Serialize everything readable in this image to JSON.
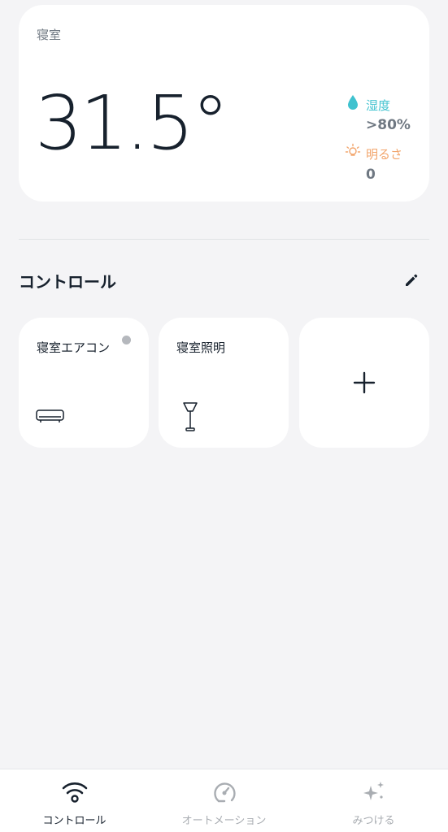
{
  "room": {
    "name": "寝室",
    "temperature": "31.5°",
    "humidity_label": "湿度",
    "humidity_value": ">80%",
    "brightness_label": "明るさ",
    "brightness_value": "0"
  },
  "controls": {
    "title": "コントロール",
    "tiles": [
      {
        "label": "寝室エアコン",
        "icon": "air-conditioner-icon",
        "status": "offline"
      },
      {
        "label": "寝室照明",
        "icon": "floor-lamp-icon"
      },
      {
        "icon": "plus-icon"
      }
    ]
  },
  "nav": {
    "items": [
      {
        "label": "コントロール",
        "icon": "wifi-icon",
        "active": true
      },
      {
        "label": "オートメーション",
        "icon": "gauge-icon",
        "active": false
      },
      {
        "label": "みつける",
        "icon": "sparkle-icon",
        "active": false
      }
    ]
  },
  "colors": {
    "humidity": "#3fc2cf",
    "brightness": "#f2a56c",
    "background": "#f4f4f6",
    "text": "#17212d",
    "muted": "#6f7882"
  }
}
